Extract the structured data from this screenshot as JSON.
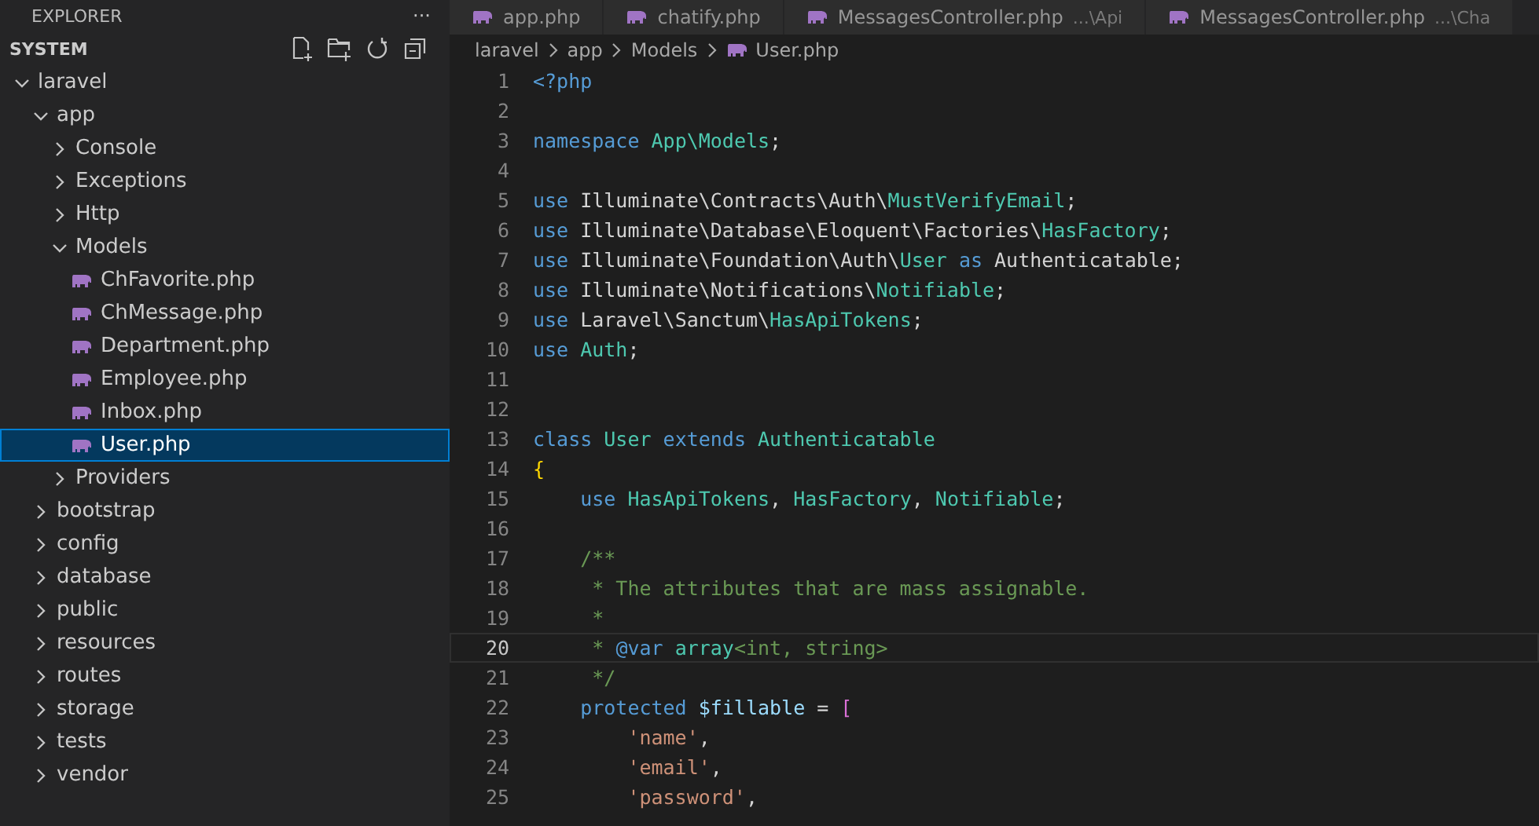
{
  "sidebar": {
    "title": "EXPLORER",
    "more": "···",
    "section": "SYSTEM",
    "tree": [
      {
        "label": "laravel",
        "kind": "folder",
        "expanded": true,
        "selected": false,
        "children": [
          {
            "label": "app",
            "kind": "folder",
            "expanded": true,
            "selected": false,
            "children": [
              {
                "label": "Console",
                "kind": "folder",
                "expanded": false,
                "selected": false
              },
              {
                "label": "Exceptions",
                "kind": "folder",
                "expanded": false,
                "selected": false
              },
              {
                "label": "Http",
                "kind": "folder",
                "expanded": false,
                "selected": false
              },
              {
                "label": "Models",
                "kind": "folder",
                "expanded": true,
                "selected": false,
                "children": [
                  {
                    "label": "ChFavorite.php",
                    "kind": "php",
                    "selected": false
                  },
                  {
                    "label": "ChMessage.php",
                    "kind": "php",
                    "selected": false
                  },
                  {
                    "label": "Department.php",
                    "kind": "php",
                    "selected": false
                  },
                  {
                    "label": "Employee.php",
                    "kind": "php",
                    "selected": false
                  },
                  {
                    "label": "Inbox.php",
                    "kind": "php",
                    "selected": false
                  },
                  {
                    "label": "User.php",
                    "kind": "php",
                    "selected": true
                  }
                ]
              },
              {
                "label": "Providers",
                "kind": "folder",
                "expanded": false,
                "selected": false
              }
            ]
          },
          {
            "label": "bootstrap",
            "kind": "folder",
            "expanded": false,
            "selected": false
          },
          {
            "label": "config",
            "kind": "folder",
            "expanded": false,
            "selected": false
          },
          {
            "label": "database",
            "kind": "folder",
            "expanded": false,
            "selected": false
          },
          {
            "label": "public",
            "kind": "folder",
            "expanded": false,
            "selected": false
          },
          {
            "label": "resources",
            "kind": "folder",
            "expanded": false,
            "selected": false
          },
          {
            "label": "routes",
            "kind": "folder",
            "expanded": false,
            "selected": false
          },
          {
            "label": "storage",
            "kind": "folder",
            "expanded": false,
            "selected": false
          },
          {
            "label": "tests",
            "kind": "folder",
            "expanded": false,
            "selected": false
          },
          {
            "label": "vendor",
            "kind": "folder",
            "expanded": false,
            "selected": false
          }
        ]
      }
    ]
  },
  "tabs": [
    {
      "label": "app.php",
      "selected": false
    },
    {
      "label": "chatify.php",
      "selected": false
    },
    {
      "label": "MessagesController.php",
      "hint": "...\\Api",
      "selected": false
    },
    {
      "label": "MessagesController.php",
      "hint": "...\\Cha",
      "selected": false
    }
  ],
  "breadcrumb": [
    "laravel",
    "app",
    "Models",
    "User.php"
  ],
  "code": [
    {
      "n": "1",
      "current": false,
      "tokens": [
        {
          "text": "<?php",
          "color": "#569cd6"
        }
      ]
    },
    {
      "n": "2",
      "current": false
    },
    {
      "n": "3",
      "current": false,
      "tokens": [
        {
          "text": "namespace ",
          "color": "#569cd6"
        },
        {
          "text": "App\\Models",
          "color": "#4ec9b0"
        },
        {
          "text": ";",
          "color": "#d4d4d4"
        }
      ]
    },
    {
      "n": "4",
      "current": false
    },
    {
      "n": "5",
      "current": false,
      "tokens": [
        {
          "text": "use ",
          "color": "#569cd6"
        },
        {
          "text": "Illuminate\\Contracts\\Auth\\",
          "color": "#d4d4d4"
        },
        {
          "text": "MustVerifyEmail",
          "color": "#4ec9b0"
        },
        {
          "text": ";",
          "color": "#d4d4d4"
        }
      ]
    },
    {
      "n": "6",
      "current": false,
      "tokens": [
        {
          "text": "use ",
          "color": "#569cd6"
        },
        {
          "text": "Illuminate\\Database\\Eloquent\\Factories\\",
          "color": "#d4d4d4"
        },
        {
          "text": "HasFactory",
          "color": "#4ec9b0"
        },
        {
          "text": ";",
          "color": "#d4d4d4"
        }
      ]
    },
    {
      "n": "7",
      "current": false,
      "tokens": [
        {
          "text": "use ",
          "color": "#569cd6"
        },
        {
          "text": "Illuminate\\Foundation\\Auth\\",
          "color": "#d4d4d4"
        },
        {
          "text": "User",
          "color": "#4ec9b0"
        },
        {
          "text": " as ",
          "color": "#569cd6"
        },
        {
          "text": "Authenticatable;",
          "color": "#d4d4d4"
        }
      ]
    },
    {
      "n": "8",
      "current": false,
      "tokens": [
        {
          "text": "use ",
          "color": "#569cd6"
        },
        {
          "text": "Illuminate\\Notifications\\",
          "color": "#d4d4d4"
        },
        {
          "text": "Notifiable",
          "color": "#4ec9b0"
        },
        {
          "text": ";",
          "color": "#d4d4d4"
        }
      ]
    },
    {
      "n": "9",
      "current": false,
      "tokens": [
        {
          "text": "use ",
          "color": "#569cd6"
        },
        {
          "text": "Laravel\\Sanctum\\",
          "color": "#d4d4d4"
        },
        {
          "text": "HasApiTokens",
          "color": "#4ec9b0"
        },
        {
          "text": ";",
          "color": "#d4d4d4"
        }
      ]
    },
    {
      "n": "10",
      "current": false,
      "tokens": [
        {
          "text": "use ",
          "color": "#569cd6"
        },
        {
          "text": "Auth",
          "color": "#4ec9b0"
        },
        {
          "text": ";",
          "color": "#d4d4d4"
        }
      ]
    },
    {
      "n": "11",
      "current": false
    },
    {
      "n": "12",
      "current": false
    },
    {
      "n": "13",
      "current": false,
      "tokens": [
        {
          "text": "class ",
          "color": "#569cd6"
        },
        {
          "text": "User",
          "color": "#4ec9b0"
        },
        {
          "text": " extends ",
          "color": "#569cd6"
        },
        {
          "text": "Authenticatable",
          "color": "#4ec9b0"
        }
      ]
    },
    {
      "n": "14",
      "current": false,
      "tokens": [
        {
          "text": "{",
          "color": "#ffd700"
        }
      ]
    },
    {
      "n": "15",
      "current": false,
      "tokens": [
        {
          "text": "    use ",
          "color": "#569cd6"
        },
        {
          "text": "HasApiTokens",
          "color": "#4ec9b0"
        },
        {
          "text": ", ",
          "color": "#d4d4d4"
        },
        {
          "text": "HasFactory",
          "color": "#4ec9b0"
        },
        {
          "text": ", ",
          "color": "#d4d4d4"
        },
        {
          "text": "Notifiable",
          "color": "#4ec9b0"
        },
        {
          "text": ";",
          "color": "#d4d4d4"
        }
      ]
    },
    {
      "n": "16",
      "current": false
    },
    {
      "n": "17",
      "current": false,
      "tokens": [
        {
          "text": "    /**",
          "color": "#6a9955"
        }
      ]
    },
    {
      "n": "18",
      "current": false,
      "tokens": [
        {
          "text": "     * The attributes that are mass assignable.",
          "color": "#6a9955"
        }
      ]
    },
    {
      "n": "19",
      "current": false,
      "tokens": [
        {
          "text": "     *",
          "color": "#6a9955"
        }
      ]
    },
    {
      "n": "20",
      "current": true,
      "tokens": [
        {
          "text": "     * ",
          "color": "#6a9955"
        },
        {
          "text": "@var",
          "color": "#569cd6"
        },
        {
          "text": " array",
          "color": "#4ec9b0"
        },
        {
          "text": "<int, string>",
          "color": "#6a9955"
        }
      ]
    },
    {
      "n": "21",
      "current": false,
      "tokens": [
        {
          "text": "     */",
          "color": "#6a9955"
        }
      ]
    },
    {
      "n": "22",
      "current": false,
      "tokens": [
        {
          "text": "    protected ",
          "color": "#569cd6"
        },
        {
          "text": "$fillable",
          "color": "#9cdcfe"
        },
        {
          "text": " = ",
          "color": "#d4d4d4"
        },
        {
          "text": "[",
          "color": "#da70d6"
        }
      ]
    },
    {
      "n": "23",
      "current": false,
      "tokens": [
        {
          "text": "        'name'",
          "color": "#ce9178"
        },
        {
          "text": ",",
          "color": "#d4d4d4"
        }
      ]
    },
    {
      "n": "24",
      "current": false,
      "tokens": [
        {
          "text": "        'email'",
          "color": "#ce9178"
        },
        {
          "text": ",",
          "color": "#d4d4d4"
        }
      ]
    },
    {
      "n": "25",
      "current": false,
      "tokens": [
        {
          "text": "        'password'",
          "color": "#ce9178"
        },
        {
          "text": ",",
          "color": "#d4d4d4"
        }
      ]
    }
  ]
}
